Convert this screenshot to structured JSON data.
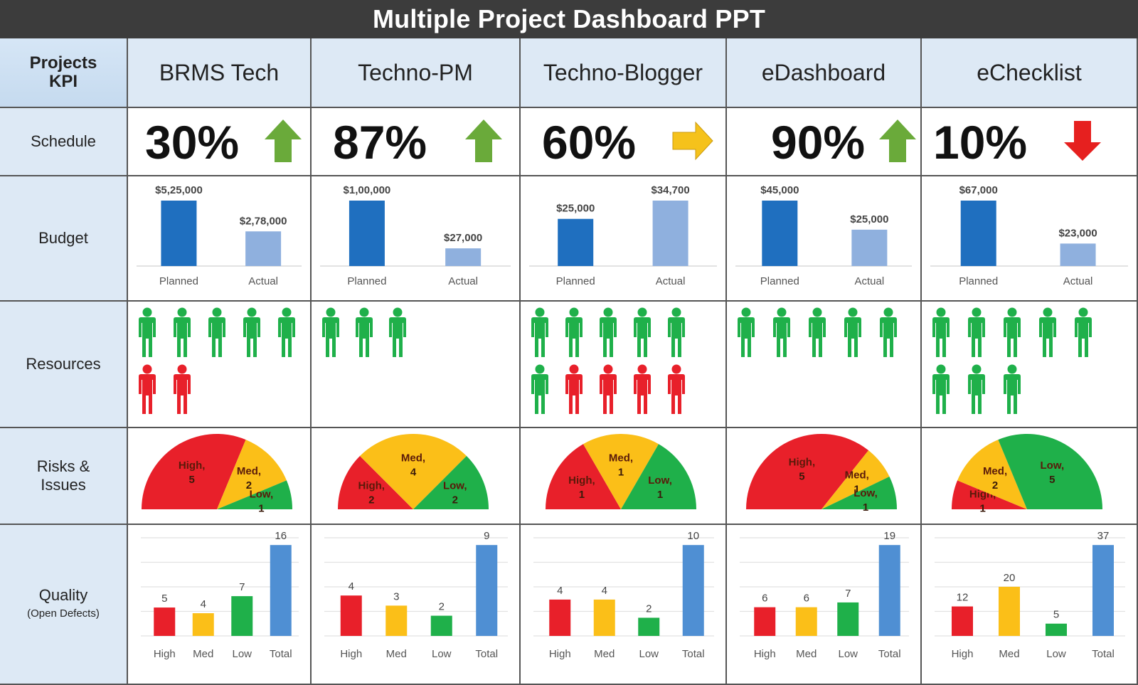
{
  "title": "Multiple Project Dashboard PPT",
  "corner_label": [
    "Projects",
    "KPI"
  ],
  "row_labels": {
    "schedule": "Schedule",
    "budget": "Budget",
    "resources": "Resources",
    "risks": [
      "Risks &",
      "Issues"
    ],
    "quality": "Quality",
    "quality_sub": "(Open Defects)"
  },
  "colors": {
    "green": "#1fb04a",
    "red": "#e8202a",
    "yellow": "#fbbf18",
    "planned": "#1f6fbf",
    "actual": "#8fb0de",
    "total": "#4f8fd3",
    "arrow_green": "#6aaa3a",
    "arrow_yellow": "#f5c21b",
    "arrow_red": "#e6201f"
  },
  "projects": [
    {
      "name": "BRMS Tech",
      "schedule": "30%",
      "trend": "up",
      "budget": {
        "planned": 525000,
        "actual": 278000,
        "planned_label": "$5,25,000",
        "actual_label": "$2,78,000"
      },
      "resources": {
        "green": 5,
        "red": 2
      },
      "risks": [
        {
          "label": "High,",
          "value": 5
        },
        {
          "label": "Med,",
          "value": 2
        },
        {
          "label": "Low,",
          "value": 1
        }
      ],
      "quality": {
        "High": 5,
        "Med": 4,
        "Low": 7,
        "Total": 16
      }
    },
    {
      "name": "Techno-PM",
      "schedule": "87%",
      "trend": "up",
      "budget": {
        "planned": 100000,
        "actual": 27000,
        "planned_label": "$1,00,000",
        "actual_label": "$27,000"
      },
      "resources": {
        "green": 3,
        "red": 0
      },
      "risks": [
        {
          "label": "High,",
          "value": 2
        },
        {
          "label": "Med,",
          "value": 4
        },
        {
          "label": "Low,",
          "value": 2
        }
      ],
      "quality": {
        "High": 4,
        "Med": 3,
        "Low": 2,
        "Total": 9
      }
    },
    {
      "name": "Techno-Blogger",
      "schedule": "60%",
      "trend": "flat",
      "budget": {
        "planned": 25000,
        "actual": 34700,
        "planned_label": "$25,000",
        "actual_label": "$34,700"
      },
      "resources": {
        "green": 6,
        "red": 4
      },
      "risks": [
        {
          "label": "High,",
          "value": 1
        },
        {
          "label": "Med,",
          "value": 1
        },
        {
          "label": "Low,",
          "value": 1
        }
      ],
      "quality": {
        "High": 4,
        "Med": 4,
        "Low": 2,
        "Total": 10
      }
    },
    {
      "name": "eDashboard",
      "schedule": "90%",
      "trend": "up",
      "budget": {
        "planned": 45000,
        "actual": 25000,
        "planned_label": "$45,000",
        "actual_label": "$25,000"
      },
      "resources": {
        "green": 5,
        "red": 0
      },
      "risks": [
        {
          "label": "High,",
          "value": 5
        },
        {
          "label": "Med,",
          "value": 1
        },
        {
          "label": "Low,",
          "value": 1
        }
      ],
      "quality": {
        "High": 6,
        "Med": 6,
        "Low": 7,
        "Total": 19
      }
    },
    {
      "name": "eChecklist",
      "schedule": "10%",
      "trend": "down",
      "budget": {
        "planned": 67000,
        "actual": 23000,
        "planned_label": "$67,000",
        "actual_label": "$23,000"
      },
      "resources": {
        "green": 8,
        "red": 0
      },
      "risks": [
        {
          "label": "High,",
          "value": 1
        },
        {
          "label": "Med,",
          "value": 2
        },
        {
          "label": "Low,",
          "value": 5
        }
      ],
      "quality": {
        "High": 12,
        "Med": 20,
        "Low": 5,
        "Total": 37
      }
    }
  ],
  "budget_axis": [
    "Planned",
    "Actual"
  ],
  "quality_axis": [
    "High",
    "Med",
    "Low",
    "Total"
  ],
  "chart_data": [
    {
      "type": "bar",
      "title": "Budget",
      "categories": [
        "Planned",
        "Actual"
      ],
      "series": [
        {
          "name": "BRMS Tech",
          "values": [
            525000,
            278000
          ]
        },
        {
          "name": "Techno-PM",
          "values": [
            100000,
            27000
          ]
        },
        {
          "name": "Techno-Blogger",
          "values": [
            25000,
            34700
          ]
        },
        {
          "name": "eDashboard",
          "values": [
            45000,
            25000
          ]
        },
        {
          "name": "eChecklist",
          "values": [
            67000,
            23000
          ]
        }
      ]
    },
    {
      "type": "pie",
      "title": "Risks & Issues (half-donut)",
      "categories": [
        "High",
        "Med",
        "Low"
      ],
      "series": [
        {
          "name": "BRMS Tech",
          "values": [
            5,
            2,
            1
          ]
        },
        {
          "name": "Techno-PM",
          "values": [
            2,
            4,
            2
          ]
        },
        {
          "name": "Techno-Blogger",
          "values": [
            1,
            1,
            1
          ]
        },
        {
          "name": "eDashboard",
          "values": [
            5,
            1,
            1
          ]
        },
        {
          "name": "eChecklist",
          "values": [
            1,
            2,
            5
          ]
        }
      ]
    },
    {
      "type": "bar",
      "title": "Quality (Open Defects)",
      "categories": [
        "High",
        "Med",
        "Low",
        "Total"
      ],
      "grid": true,
      "series": [
        {
          "name": "BRMS Tech",
          "values": [
            5,
            4,
            7,
            16
          ]
        },
        {
          "name": "Techno-PM",
          "values": [
            4,
            3,
            2,
            9
          ]
        },
        {
          "name": "Techno-Blogger",
          "values": [
            4,
            4,
            2,
            10
          ]
        },
        {
          "name": "eDashboard",
          "values": [
            6,
            6,
            7,
            19
          ]
        },
        {
          "name": "eChecklist",
          "values": [
            12,
            20,
            5,
            37
          ]
        }
      ]
    }
  ]
}
